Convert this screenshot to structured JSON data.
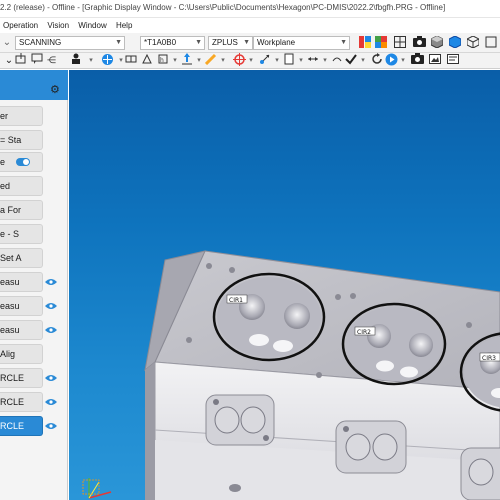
{
  "window": {
    "title": "2.2 (release) - Offline - [Graphic Display Window - C:\\Users\\Public\\Documents\\Hexagon\\PC-DMIS\\2022.2\\fbgfh.PRG - Offline]"
  },
  "menu": [
    "Operation",
    "Vision",
    "Window",
    "Help"
  ],
  "combos": {
    "mode": "SCANNING",
    "probe_tip": "*T1A0B0",
    "plane": "ZPLUS",
    "workplane": "Workplane"
  },
  "sidebar": {
    "items": [
      {
        "label": "er"
      },
      {
        "label": "= Sta"
      },
      {
        "label": "e"
      },
      {
        "label": "ed"
      },
      {
        "label": "a For"
      },
      {
        "label": "e - S"
      },
      {
        "label": "Set A"
      },
      {
        "label": "easu"
      },
      {
        "label": "easu"
      },
      {
        "label": "easu"
      },
      {
        "label": "Alig"
      },
      {
        "label": "RCLE"
      },
      {
        "label": "RCLE"
      },
      {
        "label": "RCLE"
      }
    ]
  },
  "viewport": {
    "labels": [
      "CIR1",
      "CIR2",
      "CIR3"
    ]
  },
  "colors": {
    "accent": "#2a8ad6",
    "viewport_top": "#0a5ea8",
    "viewport_bottom": "#2a96d8"
  }
}
